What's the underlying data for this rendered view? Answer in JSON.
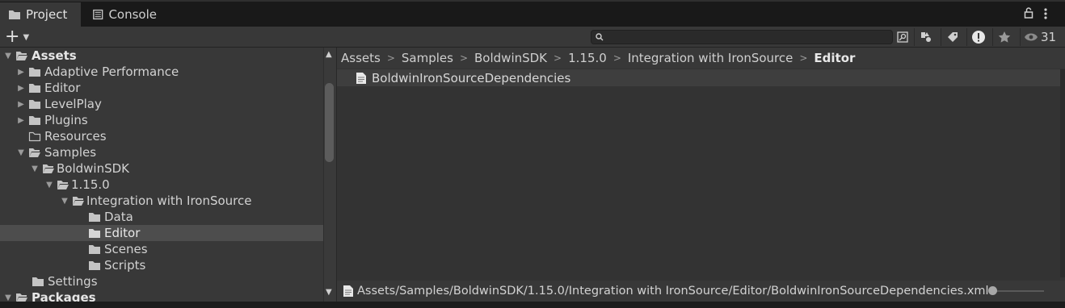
{
  "tabs": {
    "project": "Project",
    "console": "Console"
  },
  "toolbar": {
    "add_label": "+",
    "search_placeholder": "",
    "visible_count": "31"
  },
  "tree": {
    "assets": "Assets",
    "adaptive_performance": "Adaptive Performance",
    "editor": "Editor",
    "levelplay": "LevelPlay",
    "plugins": "Plugins",
    "resources": "Resources",
    "samples": "Samples",
    "boldwinsdk": "BoldwinSDK",
    "version": "1.15.0",
    "integration": "Integration with IronSource",
    "data": "Data",
    "editor_child": "Editor",
    "scenes": "Scenes",
    "scripts": "Scripts",
    "settings": "Settings",
    "packages": "Packages"
  },
  "breadcrumb": {
    "c0": "Assets",
    "c1": "Samples",
    "c2": "BoldwinSDK",
    "c3": "1.15.0",
    "c4": "Integration with IronSource",
    "c5": "Editor"
  },
  "content": {
    "file": "BoldwinIronSourceDependencies"
  },
  "footer": {
    "path": "Assets/Samples/BoldwinSDK/1.15.0/Integration with IronSource/Editor/BoldwinIronSourceDependencies.xml",
    "zoom_fraction": 0.0
  },
  "colors": {
    "folder": "#c4c4c4",
    "selected_row": "#4d4d4d",
    "text": "#d2d2d2"
  }
}
